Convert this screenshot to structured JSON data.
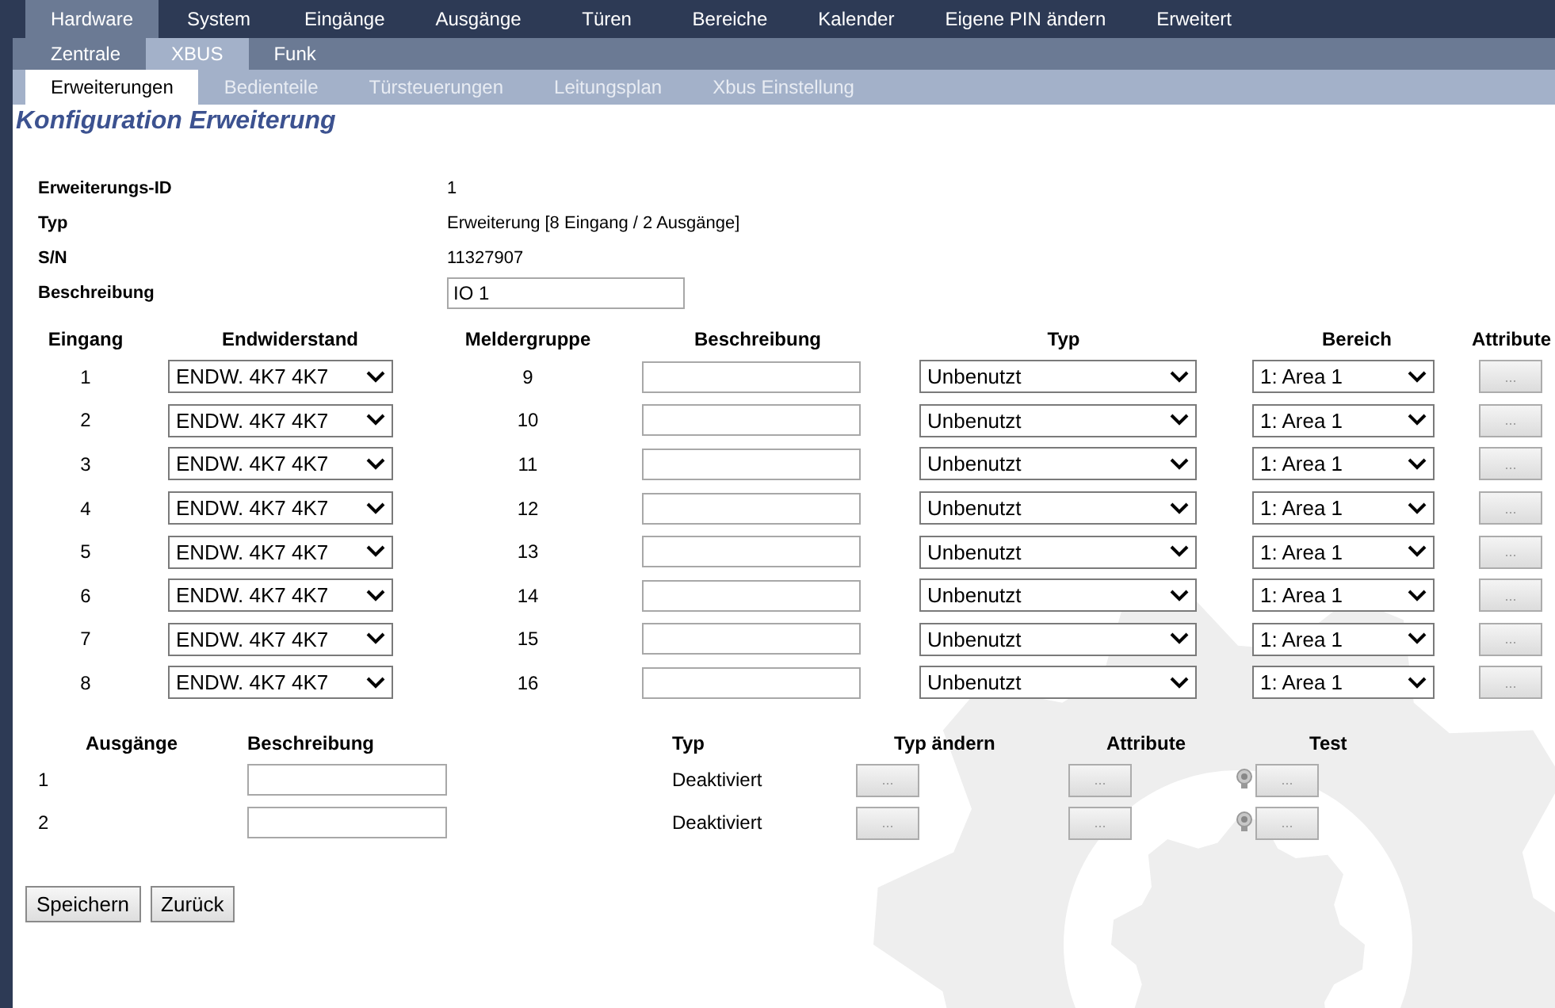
{
  "main_tabs": [
    {
      "label": "Hardware",
      "selected": true
    },
    {
      "label": "System",
      "selected": false
    },
    {
      "label": "Eingänge",
      "selected": false
    },
    {
      "label": "Ausgänge",
      "selected": false
    },
    {
      "label": "Türen",
      "selected": false
    },
    {
      "label": "Bereiche",
      "selected": false
    },
    {
      "label": "Kalender",
      "selected": false
    },
    {
      "label": "Eigene PIN ändern",
      "selected": false
    },
    {
      "label": "Erweitert",
      "selected": false
    }
  ],
  "sub_tabs": [
    {
      "label": "Zentrale",
      "selected": false
    },
    {
      "label": "XBUS",
      "selected": true
    },
    {
      "label": "Funk",
      "selected": false
    }
  ],
  "section_tabs": [
    {
      "label": "Erweiterungen",
      "selected": true
    },
    {
      "label": "Bedienteile",
      "selected": false
    },
    {
      "label": "Türsteuerungen",
      "selected": false
    },
    {
      "label": "Leitungsplan",
      "selected": false
    },
    {
      "label": "Xbus Einstellung",
      "selected": false
    }
  ],
  "heading": "Konfiguration Erweiterung",
  "info": [
    {
      "label": "Erweiterungs-ID",
      "value": "1",
      "kind": "text"
    },
    {
      "label": "Typ",
      "value": "Erweiterung [8 Eingang / 2 Ausgänge]",
      "kind": "text"
    },
    {
      "label": "S/N",
      "value": "11327907",
      "kind": "text"
    },
    {
      "label": "Beschreibung",
      "value": "IO 1",
      "kind": "field"
    }
  ],
  "inputs": {
    "columns": [
      "Eingang",
      "Endwiderstand",
      "Meldergruppe",
      "Beschreibung",
      "Typ",
      "Bereich",
      "Attribute"
    ],
    "rows": [
      {
        "number": "1",
        "resistor": "ENDW. 4K7 4K7",
        "group": "9",
        "type": "Unbenutzt",
        "area": "1: Area 1",
        "attr_button": "..."
      },
      {
        "number": "2",
        "resistor": "ENDW. 4K7 4K7",
        "group": "10",
        "type": "Unbenutzt",
        "area": "1: Area 1",
        "attr_button": "..."
      },
      {
        "number": "3",
        "resistor": "ENDW. 4K7 4K7",
        "group": "11",
        "type": "Unbenutzt",
        "area": "1: Area 1",
        "attr_button": "..."
      },
      {
        "number": "4",
        "resistor": "ENDW. 4K7 4K7",
        "group": "12",
        "type": "Unbenutzt",
        "area": "1: Area 1",
        "attr_button": "..."
      },
      {
        "number": "5",
        "resistor": "ENDW. 4K7 4K7",
        "group": "13",
        "type": "Unbenutzt",
        "area": "1: Area 1",
        "attr_button": "..."
      },
      {
        "number": "6",
        "resistor": "ENDW. 4K7 4K7",
        "group": "14",
        "type": "Unbenutzt",
        "area": "1: Area 1",
        "attr_button": "..."
      },
      {
        "number": "7",
        "resistor": "ENDW. 4K7 4K7",
        "group": "15",
        "type": "Unbenutzt",
        "area": "1: Area 1",
        "attr_button": "..."
      },
      {
        "number": "8",
        "resistor": "ENDW. 4K7 4K7",
        "group": "16",
        "type": "Unbenutzt",
        "area": "1: Area 1",
        "attr_button": "..."
      }
    ]
  },
  "outputs": {
    "columns": [
      "Ausgänge",
      "Beschreibung",
      "Typ",
      "Typ ändern",
      "Attribute",
      "Test"
    ],
    "rows": [
      {
        "number": "1",
        "type": "Deaktiviert",
        "change_button": "...",
        "attr_button": "...",
        "test_button": "..."
      },
      {
        "number": "2",
        "type": "Deaktiviert",
        "change_button": "...",
        "attr_button": "...",
        "test_button": "..."
      }
    ]
  },
  "buttons": [
    "Speichern",
    "Zurück"
  ]
}
